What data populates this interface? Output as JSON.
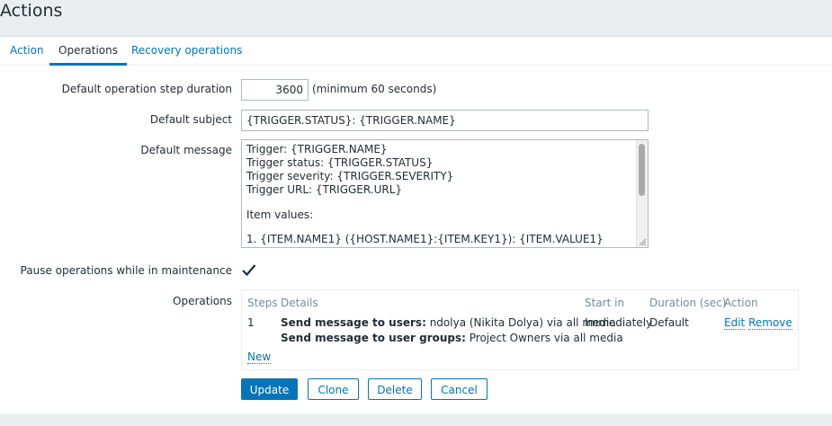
{
  "page": {
    "title": "Actions"
  },
  "tabs": [
    {
      "label": "Action"
    },
    {
      "label": "Operations"
    },
    {
      "label": "Recovery operations"
    }
  ],
  "form": {
    "step_duration": {
      "label": "Default operation step duration",
      "value": "3600",
      "hint": "(minimum 60 seconds)"
    },
    "subject": {
      "label": "Default subject",
      "value": "{TRIGGER.STATUS}: {TRIGGER.NAME}"
    },
    "message": {
      "label": "Default message",
      "lines": [
        "Trigger: {TRIGGER.NAME}",
        "Trigger status: {TRIGGER.STATUS}",
        "Trigger severity: {TRIGGER.SEVERITY}",
        "Trigger URL: {TRIGGER.URL}",
        "",
        "Item values:",
        "",
        "1. {ITEM.NAME1} ({HOST.NAME1}:{ITEM.KEY1}): {ITEM.VALUE1}"
      ]
    },
    "pause": {
      "label": "Pause operations while in maintenance",
      "checked": true
    },
    "operations": {
      "label": "Operations",
      "columns": [
        "Steps",
        "Details",
        "Start in",
        "Duration (sec)",
        "Action"
      ],
      "rows": [
        {
          "steps": "1",
          "details": [
            {
              "bold": "Send message to users:",
              "rest": " ndolya (Nikita Dolya) via all media"
            },
            {
              "bold": "Send message to user groups:",
              "rest": " Project Owners via all media"
            }
          ],
          "start_in": "Immediately",
          "duration": "Default",
          "edit": "Edit",
          "remove": "Remove"
        }
      ],
      "new_link": "New"
    }
  },
  "buttons": {
    "update": "Update",
    "clone": "Clone",
    "delete": "Delete",
    "cancel": "Cancel"
  },
  "colors": {
    "accent": "#0275b8",
    "text": "#1f2c33",
    "muted": "#768d99",
    "background": "#ebeef0"
  }
}
